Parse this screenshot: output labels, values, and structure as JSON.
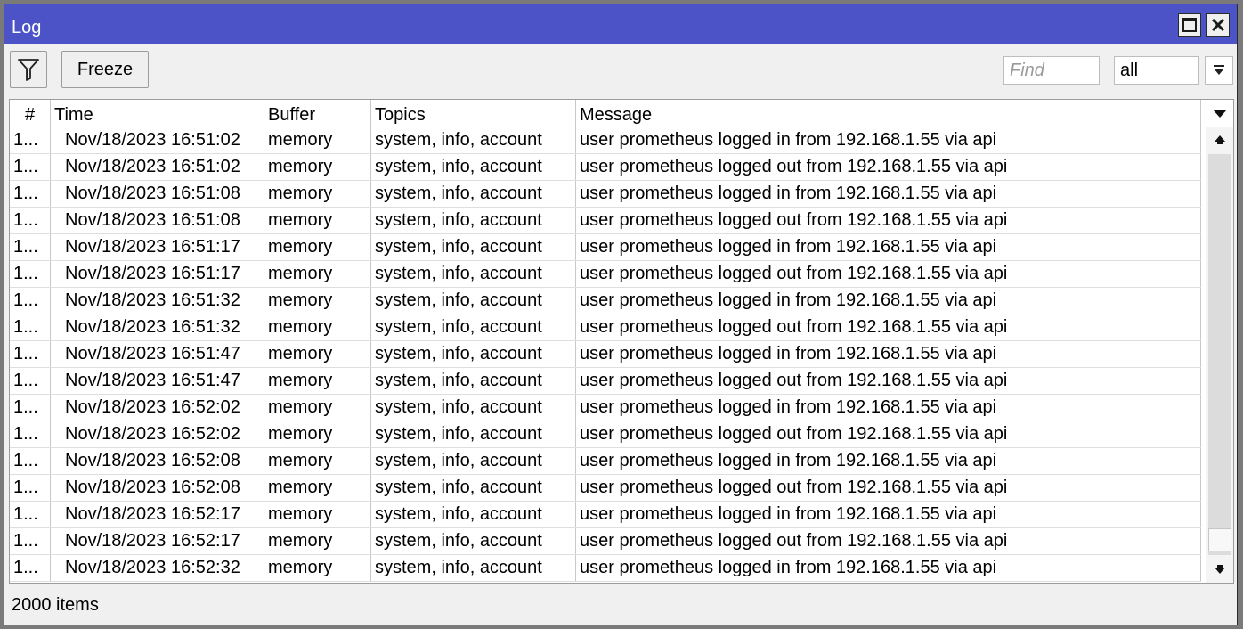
{
  "window": {
    "title": "Log"
  },
  "toolbar": {
    "filter_icon": "filter-icon",
    "freeze_label": "Freeze",
    "find_placeholder": "Find",
    "find_value": "",
    "topics_select_value": "all"
  },
  "table": {
    "columns": [
      "#",
      "Time",
      "Buffer",
      "Topics",
      "Message"
    ],
    "rows": [
      {
        "num": "1...",
        "time": "Nov/18/2023 16:51:02",
        "buffer": "memory",
        "topics": "system, info, account",
        "message": "user prometheus logged in from 192.168.1.55 via api"
      },
      {
        "num": "1...",
        "time": "Nov/18/2023 16:51:02",
        "buffer": "memory",
        "topics": "system, info, account",
        "message": "user prometheus logged out from 192.168.1.55 via api"
      },
      {
        "num": "1...",
        "time": "Nov/18/2023 16:51:08",
        "buffer": "memory",
        "topics": "system, info, account",
        "message": "user prometheus logged in from 192.168.1.55 via api"
      },
      {
        "num": "1...",
        "time": "Nov/18/2023 16:51:08",
        "buffer": "memory",
        "topics": "system, info, account",
        "message": "user prometheus logged out from 192.168.1.55 via api"
      },
      {
        "num": "1...",
        "time": "Nov/18/2023 16:51:17",
        "buffer": "memory",
        "topics": "system, info, account",
        "message": "user prometheus logged in from 192.168.1.55 via api"
      },
      {
        "num": "1...",
        "time": "Nov/18/2023 16:51:17",
        "buffer": "memory",
        "topics": "system, info, account",
        "message": "user prometheus logged out from 192.168.1.55 via api"
      },
      {
        "num": "1...",
        "time": "Nov/18/2023 16:51:32",
        "buffer": "memory",
        "topics": "system, info, account",
        "message": "user prometheus logged in from 192.168.1.55 via api"
      },
      {
        "num": "1...",
        "time": "Nov/18/2023 16:51:32",
        "buffer": "memory",
        "topics": "system, info, account",
        "message": "user prometheus logged out from 192.168.1.55 via api"
      },
      {
        "num": "1...",
        "time": "Nov/18/2023 16:51:47",
        "buffer": "memory",
        "topics": "system, info, account",
        "message": "user prometheus logged in from 192.168.1.55 via api"
      },
      {
        "num": "1...",
        "time": "Nov/18/2023 16:51:47",
        "buffer": "memory",
        "topics": "system, info, account",
        "message": "user prometheus logged out from 192.168.1.55 via api"
      },
      {
        "num": "1...",
        "time": "Nov/18/2023 16:52:02",
        "buffer": "memory",
        "topics": "system, info, account",
        "message": "user prometheus logged in from 192.168.1.55 via api"
      },
      {
        "num": "1...",
        "time": "Nov/18/2023 16:52:02",
        "buffer": "memory",
        "topics": "system, info, account",
        "message": "user prometheus logged out from 192.168.1.55 via api"
      },
      {
        "num": "1...",
        "time": "Nov/18/2023 16:52:08",
        "buffer": "memory",
        "topics": "system, info, account",
        "message": "user prometheus logged in from 192.168.1.55 via api"
      },
      {
        "num": "1...",
        "time": "Nov/18/2023 16:52:08",
        "buffer": "memory",
        "topics": "system, info, account",
        "message": "user prometheus logged out from 192.168.1.55 via api"
      },
      {
        "num": "1...",
        "time": "Nov/18/2023 16:52:17",
        "buffer": "memory",
        "topics": "system, info, account",
        "message": "user prometheus logged in from 192.168.1.55 via api"
      },
      {
        "num": "1...",
        "time": "Nov/18/2023 16:52:17",
        "buffer": "memory",
        "topics": "system, info, account",
        "message": "user prometheus logged out from 192.168.1.55 via api"
      },
      {
        "num": "1...",
        "time": "Nov/18/2023 16:52:32",
        "buffer": "memory",
        "topics": "system, info, account",
        "message": "user prometheus logged in from 192.168.1.55 via api"
      }
    ]
  },
  "scrollbar": {
    "position_fraction": 0.99
  },
  "status": {
    "item_count": "2000 items"
  },
  "colors": {
    "titlebar": "#4c53c7",
    "window_bg": "#f0f0f0"
  }
}
